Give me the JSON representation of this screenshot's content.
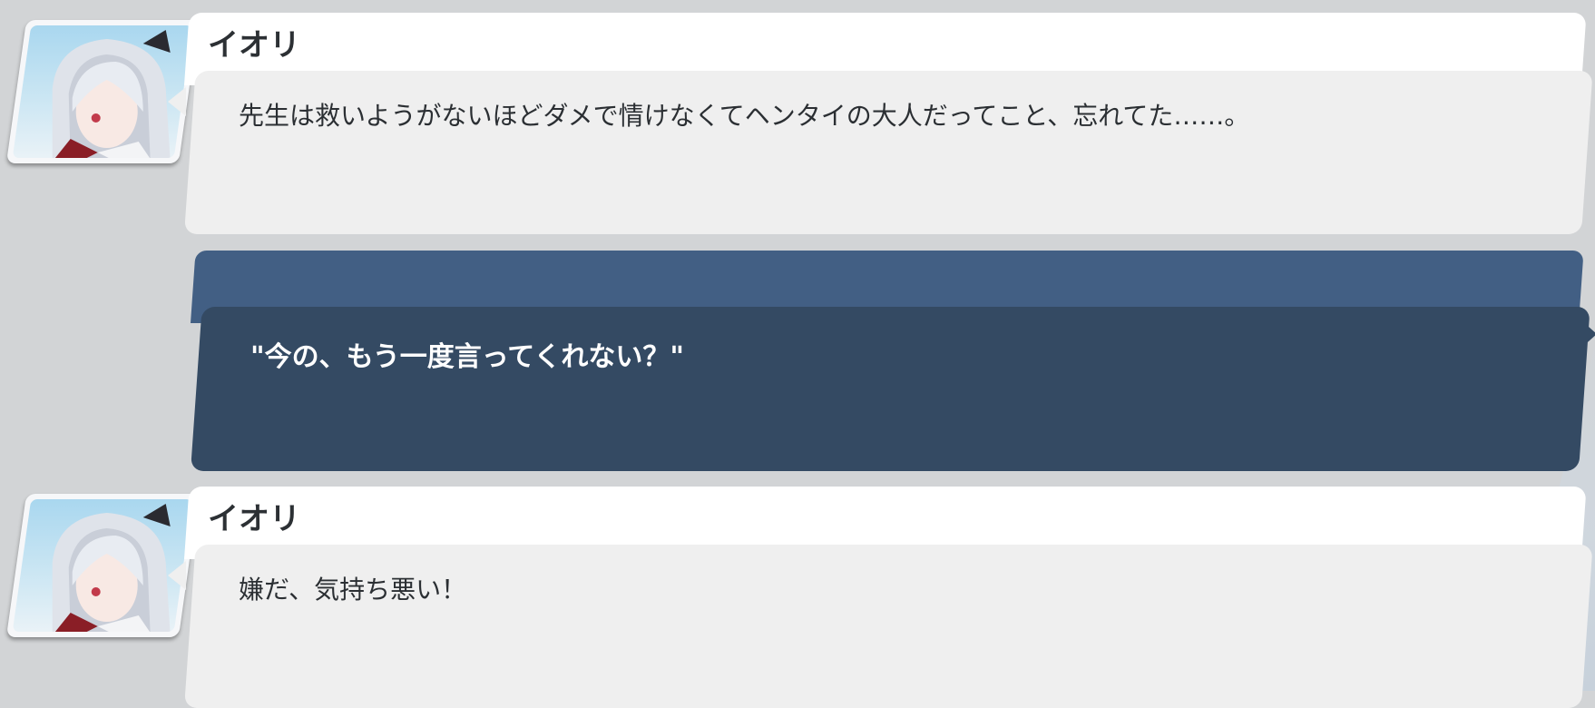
{
  "dialogue": [
    {
      "type": "npc",
      "speaker": "イオリ",
      "message": "先生は救いようがないほどダメで情けなくてヘンタイの大人だってこと、忘れてた……。",
      "avatar_icon": "character-portrait-iori"
    },
    {
      "type": "player_choice",
      "message": "\"今の、もう一度言ってくれない？\""
    },
    {
      "type": "npc",
      "speaker": "イオリ",
      "message": "嫌だ、気持ち悪い！",
      "avatar_icon": "character-portrait-iori"
    }
  ],
  "colors": {
    "background": "#d2d4d6",
    "npc_name_bar": "#ffffff",
    "npc_body": "#efefef",
    "choice_top": "#425f84",
    "choice_body": "#344a63",
    "text_dark": "#2b2f33",
    "text_light": "#ffffff"
  }
}
